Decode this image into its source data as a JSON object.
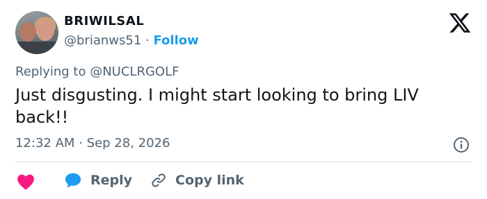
{
  "author": {
    "display_name": "BRIWILSAL",
    "handle": "@brianws51",
    "separator": "·",
    "follow_label": "Follow"
  },
  "reply_context": {
    "prefix": "Replying to",
    "mention": "@NUCLRGOLF"
  },
  "tweet": {
    "text": "Just disgusting. I might start looking to bring LIV back!!",
    "time": "12:32 AM",
    "separator": "·",
    "date": "Sep 28, 2026"
  },
  "actions": {
    "reply_label": "Reply",
    "copy_link_label": "Copy link"
  },
  "colors": {
    "accent": "#1d9bf0",
    "like": "#f91880",
    "secondary_text": "#536471",
    "divider": "#cfd9de"
  },
  "icons": {
    "platform": "x-logo-icon",
    "info": "info-icon",
    "like": "heart-icon",
    "reply": "speech-bubble-icon",
    "copy": "link-icon"
  }
}
